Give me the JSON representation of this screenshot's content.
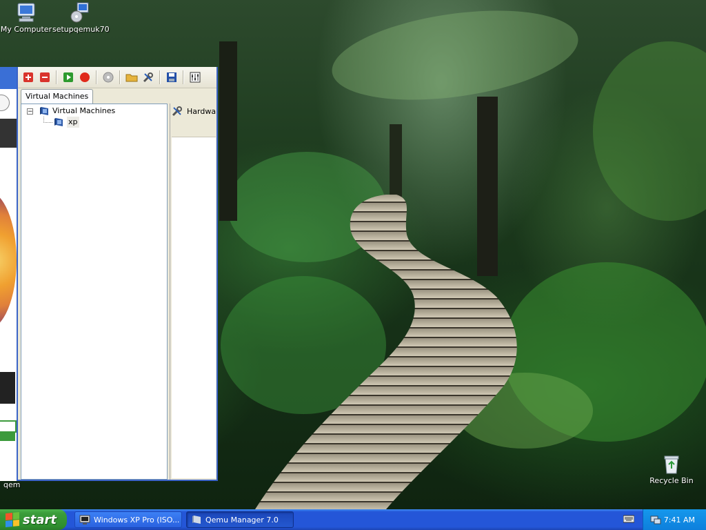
{
  "desktop": {
    "icons": [
      {
        "label": "My Computer",
        "icon": "my-computer-icon"
      },
      {
        "label": "setupqemuk70",
        "icon": "setup-installer-icon"
      },
      {
        "label": "Recycle Bin",
        "icon": "recycle-bin-icon"
      }
    ],
    "partial_label": "qem"
  },
  "qemu_manager": {
    "toolbar": [
      {
        "name": "add-vm-button",
        "icon": "plus-icon",
        "color": "#d9342b"
      },
      {
        "name": "remove-vm-button",
        "icon": "minus-icon",
        "color": "#d9342b"
      },
      {
        "name": "start-vm-button",
        "icon": "play-icon",
        "color": "#2e9a2e"
      },
      {
        "name": "stop-vm-button",
        "icon": "stop-icon",
        "color": "#e02a1a"
      },
      {
        "name": "cdrom-button",
        "icon": "cd-icon",
        "color": "#9a9a9a"
      },
      {
        "name": "open-folder-button",
        "icon": "folder-icon",
        "color": "#e6b33c"
      },
      {
        "name": "settings-button",
        "icon": "tools-icon",
        "color": "#555555"
      },
      {
        "name": "save-button",
        "icon": "floppy-icon",
        "color": "#2450a8"
      },
      {
        "name": "options-button",
        "icon": "sliders-icon",
        "color": "#333333"
      }
    ],
    "tab_label": "Virtual Machines",
    "tree": {
      "root_label": "Virtual Machines",
      "expander": "−",
      "children": [
        {
          "label": "xp"
        }
      ]
    },
    "right_pane": {
      "hardware_label": "Hardwa"
    }
  },
  "taskbar": {
    "start_label": "start",
    "tasks": [
      {
        "label": "Windows XP Pro (ISO...",
        "active": false
      },
      {
        "label": "Qemu Manager 7.0",
        "active": true
      }
    ],
    "clock": "7:41 AM"
  },
  "colors": {
    "taskbar_blue": "#2456d8",
    "start_green": "#3a9c3a",
    "window_border": "#3a63c7"
  }
}
